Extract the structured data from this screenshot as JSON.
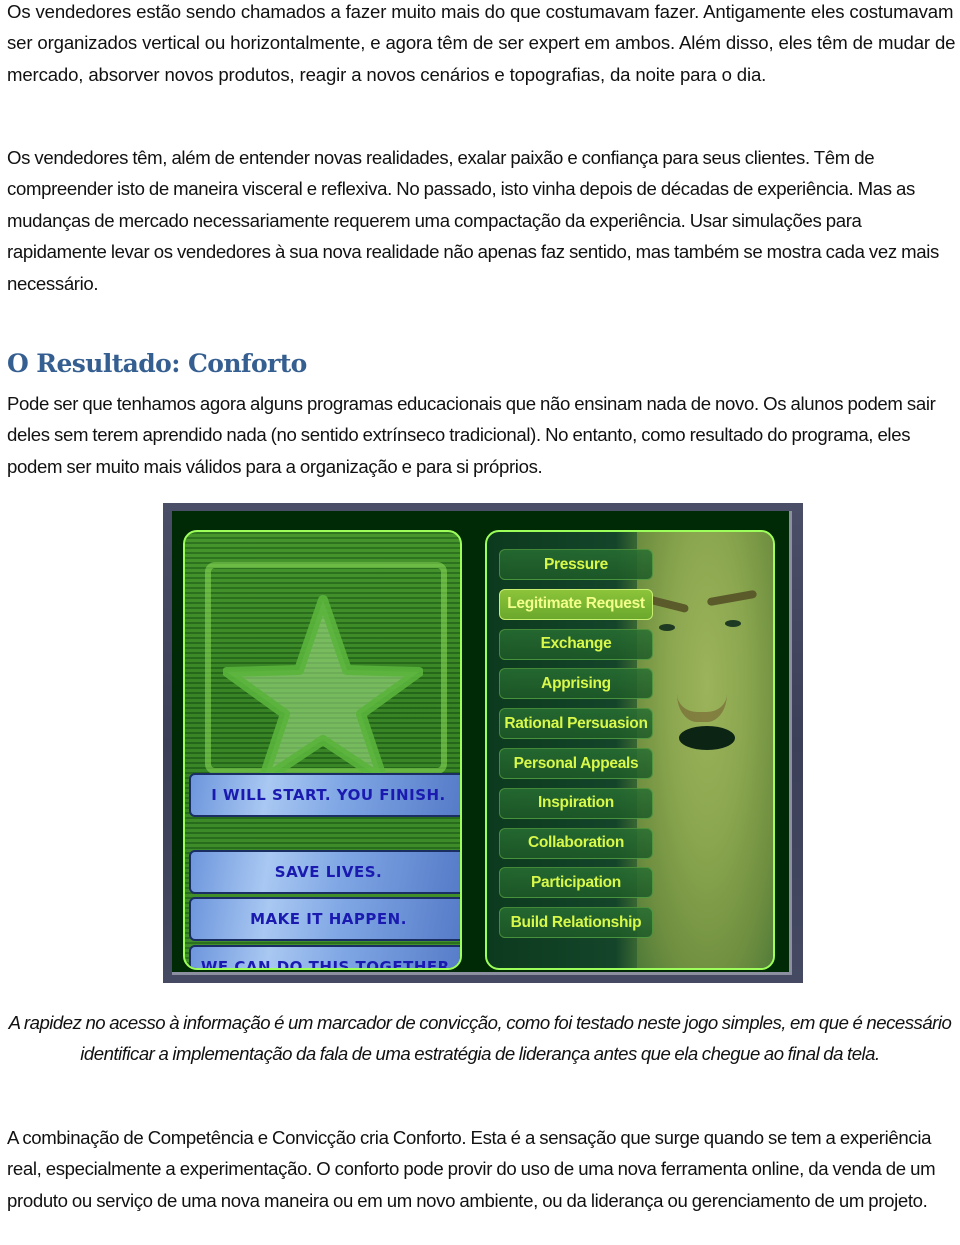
{
  "paragraphs": {
    "intro": "Os vendedores estão sendo chamados a fazer muito mais do que costumavam fazer. Antigamente eles costumavam ser organizados vertical ou horizontalmente, e agora têm de ser expert em ambos. Além disso, eles têm de mudar de mercado, absorver novos produtos, reagir a novos cenários e topografias, da noite para o dia.",
    "second": "Os vendedores têm, além de entender novas realidades, exalar paixão e confiança para seus clientes. Têm de compreender isto de maneira visceral e reflexiva. No passado, isto vinha depois de décadas de experiência.  Mas as mudanças de mercado necessariamente requerem uma compactação da experiência.  Usar simulações para rapidamente levar os vendedores à sua nova realidade não apenas faz sentido, mas também se mostra cada vez mais necessário."
  },
  "section": {
    "heading": "O Resultado: Conforto",
    "body": "Pode ser que tenhamos agora alguns programas educacionais que não ensinam nada de novo. Os alunos podem sair deles sem terem aprendido nada (no sentido extrínseco tradicional). No entanto, como resultado do programa, eles podem ser muito mais válidos para a organização e para si próprios."
  },
  "game": {
    "slogans": [
      "I will start. You finish.",
      "Save lives.",
      "Make it happen.",
      "We can do this together."
    ],
    "strategies": [
      {
        "label": "Pressure",
        "active": false
      },
      {
        "label": "Legitimate Request",
        "active": true
      },
      {
        "label": "Exchange",
        "active": false
      },
      {
        "label": "Apprising",
        "active": false
      },
      {
        "label": "Rational Persuasion",
        "active": false
      },
      {
        "label": "Personal Appeals",
        "active": false
      },
      {
        "label": "Inspiration",
        "active": false
      },
      {
        "label": "Collaboration",
        "active": false
      },
      {
        "label": "Participation",
        "active": false
      },
      {
        "label": "Build Relationship",
        "active": false
      }
    ]
  },
  "caption": "A rapidez no acesso à informação é um marcador de convicção, como foi testado neste jogo simples, em que é necessário identificar a implementação da fala de uma estratégia de liderança antes que ela chegue ao final da tela.",
  "closing": "A combinação de Competência e Convicção cria Conforto. Esta é a sensação que surge quando se tem a experiência real, especialmente a experimentação. O conforto pode provir do uso de uma nova ferramenta online, da venda de um produto ou serviço de uma nova maneira ou em um novo ambiente, ou da liderança ou gerenciamento de um projeto.",
  "colors": {
    "heading": "#365f91",
    "slogan_text": "#1a1ab0",
    "strategy_text": "#d8f84a",
    "panel_border": "#9cff5a"
  }
}
